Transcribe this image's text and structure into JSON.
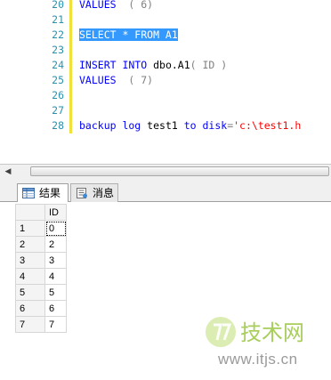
{
  "editor": {
    "lines": [
      {
        "num": "20",
        "parts": [
          {
            "t": "VALUES",
            "c": "kw"
          },
          {
            "t": "  ( 6)",
            "c": "gray"
          }
        ]
      },
      {
        "num": "21",
        "parts": []
      },
      {
        "num": "22",
        "parts": [
          {
            "t": "SELECT * FROM A1",
            "c": "sel"
          }
        ]
      },
      {
        "num": "23",
        "parts": []
      },
      {
        "num": "24",
        "parts": [
          {
            "t": "INSERT INTO",
            "c": "kw"
          },
          {
            "t": " dbo.A1",
            "c": "id"
          },
          {
            "t": "( ID )",
            "c": "gray"
          }
        ]
      },
      {
        "num": "25",
        "parts": [
          {
            "t": "VALUES",
            "c": "kw"
          },
          {
            "t": "  ( 7)",
            "c": "gray"
          }
        ]
      },
      {
        "num": "26",
        "parts": []
      },
      {
        "num": "27",
        "parts": []
      },
      {
        "num": "28",
        "parts": [
          {
            "t": "backup log",
            "c": "kw"
          },
          {
            "t": " test1 ",
            "c": "id"
          },
          {
            "t": "to disk",
            "c": "kw"
          },
          {
            "t": "=",
            "c": "gray"
          },
          {
            "t": "'c:\\test1.h",
            "c": "str"
          }
        ]
      }
    ]
  },
  "results": {
    "tabs": [
      {
        "label": "结果",
        "icon": "grid-icon"
      },
      {
        "label": "消息",
        "icon": "messages-icon"
      }
    ],
    "columns": [
      "ID"
    ],
    "rows": [
      {
        "n": "1",
        "id": "0"
      },
      {
        "n": "2",
        "id": "2"
      },
      {
        "n": "3",
        "id": "3"
      },
      {
        "n": "4",
        "id": "4"
      },
      {
        "n": "5",
        "id": "5"
      },
      {
        "n": "6",
        "id": "6"
      },
      {
        "n": "7",
        "id": "7"
      }
    ]
  },
  "watermark": {
    "logo_text": "技术网",
    "url": "www.itjs.cn"
  },
  "colors": {
    "keyword": "#0000ff",
    "line_number": "#2b91af",
    "selection": "#3399ff",
    "string": "#ff0000",
    "change_bar": "#f0e23a"
  }
}
